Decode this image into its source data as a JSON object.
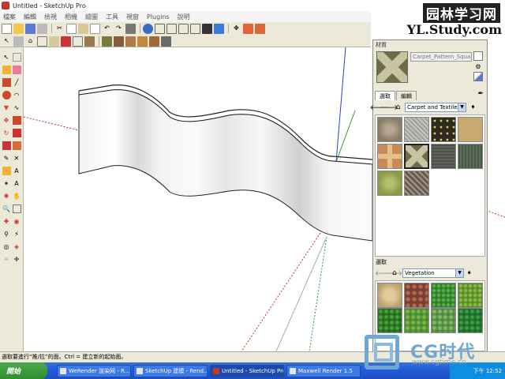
{
  "window": {
    "title": "Untitled - SketchUp Pro"
  },
  "menu": [
    "檔案",
    "編輯",
    "檢視",
    "相機",
    "繪圖",
    "工具",
    "視窗",
    "Plugins",
    "說明"
  ],
  "watermark_top": {
    "chinese": "园林学习网",
    "url": "YL.Study.com"
  },
  "materials_panel": {
    "title": "材質",
    "material_name": "Carpet_Pattern_Squares",
    "tabs": [
      "選取",
      "編輯"
    ],
    "collection_top": "Carpet and Textiles",
    "lower_label": "選取",
    "collection_bottom": "Vegetation",
    "colors": {
      "swatches_top": [
        "#9b8d7a",
        "#b5b5b0",
        "#3a3525",
        "#c8aa6e",
        "#c98a5a",
        "#8a8b5a",
        "#4d5048",
        "#4a5a48",
        "#9aa655",
        "#6b5b4e"
      ],
      "swatches_bottom": [
        "#c9b48a",
        "#9a5a46",
        "#4a9a3a",
        "#6ea03a",
        "#3a8a2a",
        "#5a9a3a",
        "#6fa050",
        "#2f8a3a"
      ]
    }
  },
  "status_bar": {
    "text": "選取要進行“推/拉”的面。Ctrl = 建立新的起始面。"
  },
  "taskbar": {
    "start": "開始",
    "tasks": [
      "WeRender 渲染网 - R...",
      "SketchUp 建模 - Rend...",
      "Untitled - SketchUp Pro",
      "Maxwell Render 1.5"
    ],
    "clock": "下午 12:52"
  },
  "watermark_bottom": {
    "brand": "CG时代",
    "site": "www.cgtime.cn"
  }
}
